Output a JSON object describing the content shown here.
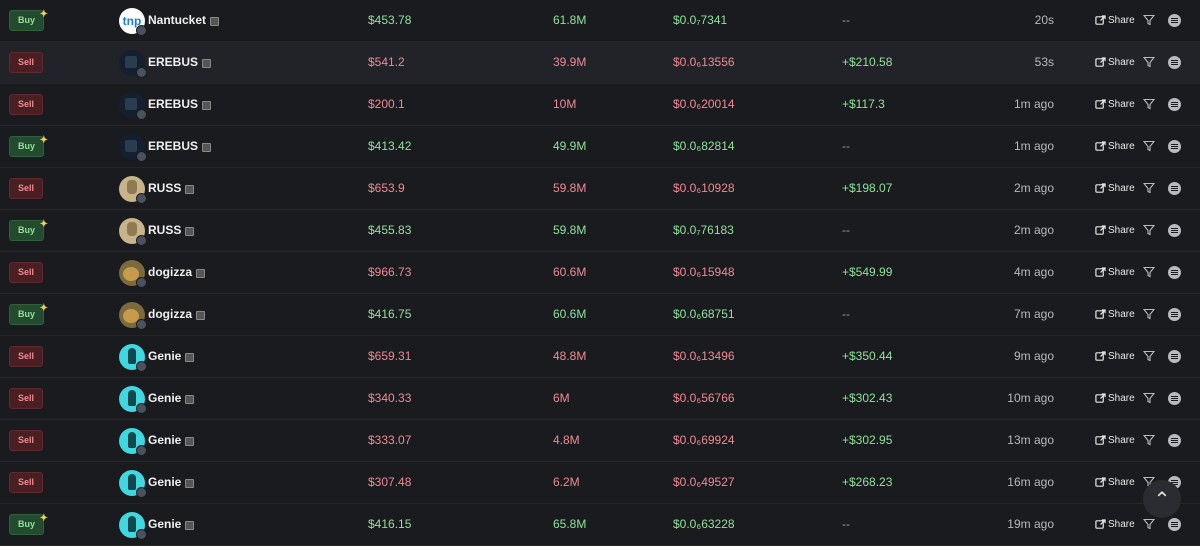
{
  "colors": {
    "buy": "#8fe39a",
    "sell": "#f08a92",
    "bg": "#1a1b1f"
  },
  "share_label": "Share",
  "rows": [
    {
      "type": "Buy",
      "trader": "Nantucket",
      "avatar": "tnp",
      "avatar_text": "tnp",
      "usd": "$453.78",
      "amount": "61.8M",
      "price": "$0.0₇7341",
      "pnl": "--",
      "age": "20s"
    },
    {
      "type": "Sell",
      "trader": "EREBUS",
      "avatar": "erebus",
      "usd": "$541.2",
      "amount": "39.9M",
      "price": "$0.0₆13556",
      "pnl": "+$210.58",
      "age": "53s"
    },
    {
      "type": "Sell",
      "trader": "EREBUS",
      "avatar": "erebus",
      "usd": "$200.1",
      "amount": "10M",
      "price": "$0.0₆20014",
      "pnl": "+$117.3",
      "age": "1m ago"
    },
    {
      "type": "Buy",
      "trader": "EREBUS",
      "avatar": "erebus",
      "usd": "$413.42",
      "amount": "49.9M",
      "price": "$0.0₆82814",
      "pnl": "--",
      "age": "1m ago"
    },
    {
      "type": "Sell",
      "trader": "RUSS",
      "avatar": "russ",
      "usd": "$653.9",
      "amount": "59.8M",
      "price": "$0.0₆10928",
      "pnl": "+$198.07",
      "age": "2m ago"
    },
    {
      "type": "Buy",
      "trader": "RUSS",
      "avatar": "russ",
      "usd": "$455.83",
      "amount": "59.8M",
      "price": "$0.0₇76183",
      "pnl": "--",
      "age": "2m ago"
    },
    {
      "type": "Sell",
      "trader": "dogizza",
      "avatar": "dogizza",
      "usd": "$966.73",
      "amount": "60.6M",
      "price": "$0.0₆15948",
      "pnl": "+$549.99",
      "age": "4m ago"
    },
    {
      "type": "Buy",
      "trader": "dogizza",
      "avatar": "dogizza",
      "usd": "$416.75",
      "amount": "60.6M",
      "price": "$0.0₆68751",
      "pnl": "--",
      "age": "7m ago"
    },
    {
      "type": "Sell",
      "trader": "Genie",
      "avatar": "genie",
      "usd": "$659.31",
      "amount": "48.8M",
      "price": "$0.0₆13496",
      "pnl": "+$350.44",
      "age": "9m ago"
    },
    {
      "type": "Sell",
      "trader": "Genie",
      "avatar": "genie",
      "usd": "$340.33",
      "amount": "6M",
      "price": "$0.0₆56766",
      "pnl": "+$302.43",
      "age": "10m ago"
    },
    {
      "type": "Sell",
      "trader": "Genie",
      "avatar": "genie",
      "usd": "$333.07",
      "amount": "4.8M",
      "price": "$0.0₆69924",
      "pnl": "+$302.95",
      "age": "13m ago"
    },
    {
      "type": "Sell",
      "trader": "Genie",
      "avatar": "genie",
      "usd": "$307.48",
      "amount": "6.2M",
      "price": "$0.0₆49527",
      "pnl": "+$268.23",
      "age": "16m ago"
    },
    {
      "type": "Buy",
      "trader": "Genie",
      "avatar": "genie",
      "usd": "$416.15",
      "amount": "65.8M",
      "price": "$0.0₆63228",
      "pnl": "--",
      "age": "19m ago"
    }
  ]
}
